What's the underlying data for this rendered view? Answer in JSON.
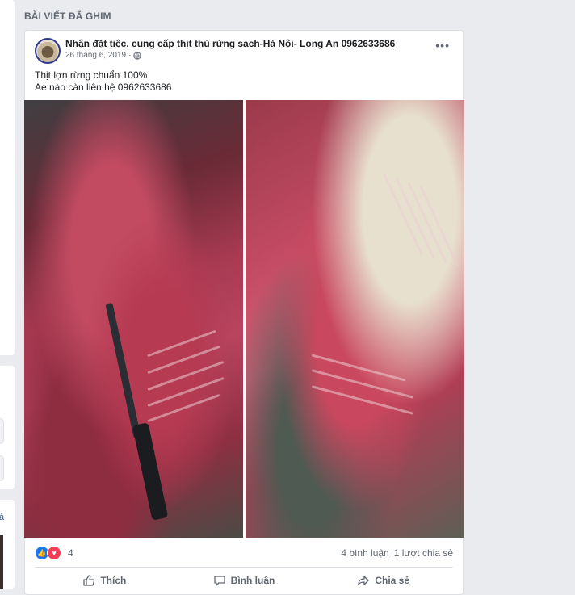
{
  "section": {
    "title": "BÀI VIẾT ĐÃ GHIM"
  },
  "left_column": {
    "partial_link": "ả"
  },
  "post": {
    "author": "Nhận đặt tiệc, cung cấp thịt thú rừng sạch-Hà Nội- Long An 0962633686",
    "date": "26 tháng 6, 2019",
    "separator": "·",
    "privacy_icon": "globe-icon",
    "more_icon": "more-options-icon",
    "more_label": "•••",
    "text_lines": [
      "Thịt lợn rừng chuẩn 100%",
      "Ae nào càn liên hệ 0962633686"
    ],
    "reactions": {
      "icons": [
        "like",
        "love"
      ],
      "count": "4"
    },
    "comments": "4 bình luận",
    "shares": "1 lượt chia sẻ",
    "actions": {
      "like": "Thích",
      "comment": "Bình luận",
      "share": "Chia sẻ"
    }
  },
  "colors": {
    "background": "#e9ebee",
    "card": "#ffffff",
    "muted_text": "#606770",
    "like_blue": "#1877f2",
    "love_red": "#f33e58"
  }
}
